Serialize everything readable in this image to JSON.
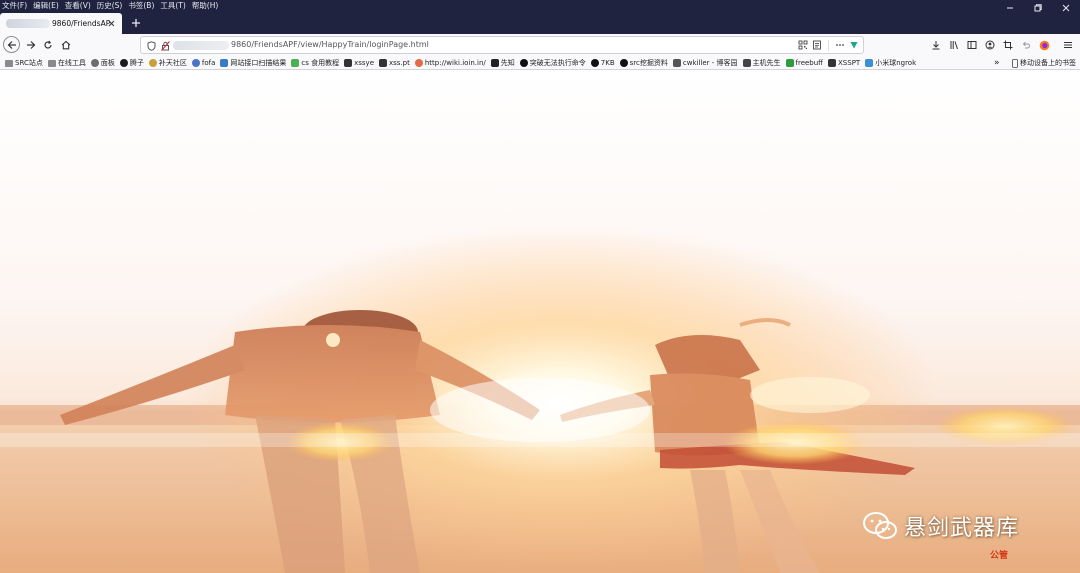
{
  "menu": [
    "文件(F)",
    "编辑(E)",
    "查看(V)",
    "历史(S)",
    "书签(B)",
    "工具(T)",
    "帮助(H)"
  ],
  "tab": {
    "title": "9860/FriendsAPF/"
  },
  "url": {
    "text": "9860/FriendsAPF/view/HappyTrain/loginPage.html"
  },
  "bookmarks": [
    {
      "label": "SRC站点",
      "icon": "folder-icon",
      "color": "#8a8a8a"
    },
    {
      "label": "在线工具",
      "icon": "folder-icon",
      "color": "#8a8a8a"
    },
    {
      "label": "面板",
      "icon": "globe-icon",
      "color": "#6d6d6d"
    },
    {
      "label": "腾子",
      "icon": "circle-icon",
      "color": "#1c1c1c"
    },
    {
      "label": "补天社区",
      "icon": "badge-icon",
      "color": "#c9a13b"
    },
    {
      "label": "fofa",
      "icon": "globe-icon",
      "color": "#4a73c9"
    },
    {
      "label": "网站接口扫描结果",
      "icon": "page-icon",
      "color": "#3b7ac9"
    },
    {
      "label": "cs 食用教程",
      "icon": "play-icon",
      "color": "#4caf50"
    },
    {
      "label": "xssye",
      "icon": "ghost-icon",
      "color": "#333333"
    },
    {
      "label": "xss.pt",
      "icon": "x-icon",
      "color": "#333333"
    },
    {
      "label": "http://wiki.ioin.in/",
      "icon": "circle-icon",
      "color": "#e26b4a"
    },
    {
      "label": "先知",
      "icon": "logo-icon",
      "color": "#222222"
    },
    {
      "label": "突破无法执行命令",
      "icon": "github-icon",
      "color": "#111111"
    },
    {
      "label": "7KB",
      "icon": "github-icon",
      "color": "#111111"
    },
    {
      "label": "src挖掘资料",
      "icon": "github-icon",
      "color": "#111111"
    },
    {
      "label": "cwkiller - 博客园",
      "icon": "logo-icon",
      "color": "#555555"
    },
    {
      "label": "主机先生",
      "icon": "pin-icon",
      "color": "#444444"
    },
    {
      "label": "freebuff",
      "icon": "page-icon",
      "color": "#2e9b3e"
    },
    {
      "label": "XSSPT",
      "icon": "ghost-icon",
      "color": "#333333"
    },
    {
      "label": "小米球ngrok",
      "icon": "plane-icon",
      "color": "#3a8fd6"
    }
  ],
  "bookmarks_overflow": "»",
  "mobile_bookmarks": "移动设备上的书签",
  "watermark": {
    "text": "悬剑武器库",
    "sub": "公管"
  }
}
